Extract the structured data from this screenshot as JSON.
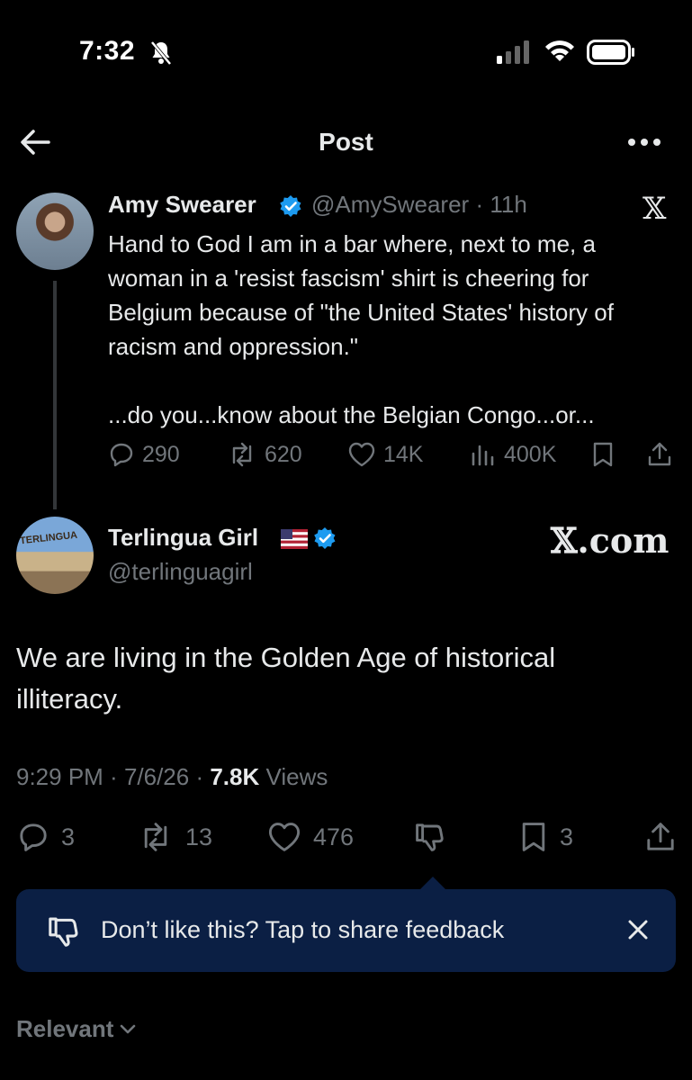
{
  "status_bar": {
    "time": "7:32"
  },
  "header": {
    "title": "Post"
  },
  "quoted_post": {
    "author_name": "Amy Swearer",
    "author_handle": "@AmySwearer",
    "age": "11h",
    "text": "Hand to God I am in a bar where, next to me, a woman in a 'resist fascism' shirt is cheering for Belgium because of \"the United States' history of racism and oppression.\"\n\n...do you...know about the Belgian Congo...or...",
    "metrics": {
      "replies": "290",
      "reposts": "620",
      "likes": "14K",
      "views": "400K"
    }
  },
  "main_post": {
    "author_name": "Terlingua Girl",
    "author_handle": "@terlinguagirl",
    "brand_text": "𝕏.com",
    "avatar_sign_text": "TERLINGUA",
    "text": "We are living in the Golden Age of historical illiteracy.",
    "time": "9:29 PM",
    "date": "7/6/26",
    "views_count": "7.8K",
    "views_label": "Views",
    "actions": {
      "replies": "3",
      "reposts": "13",
      "likes": "476",
      "bookmarks": "3"
    }
  },
  "feedback_banner": {
    "text": "Don’t like this? Tap to share feedback"
  },
  "sort": {
    "label": "Relevant"
  },
  "icons": [
    "bell-slash-icon",
    "signal-icon",
    "wifi-icon",
    "battery-icon",
    "back-arrow-icon",
    "more-icon",
    "verified-icon",
    "x-logo-icon",
    "reply-icon",
    "repost-icon",
    "like-icon",
    "views-icon",
    "bookmark-icon",
    "share-icon",
    "flag-icon",
    "dislike-icon",
    "close-icon",
    "chevron-down-icon"
  ],
  "colors": {
    "background": "#000000",
    "text": "#e7e9ea",
    "muted": "#71767b",
    "verified": "#1d9bf0",
    "banner": "#0b1f44"
  }
}
